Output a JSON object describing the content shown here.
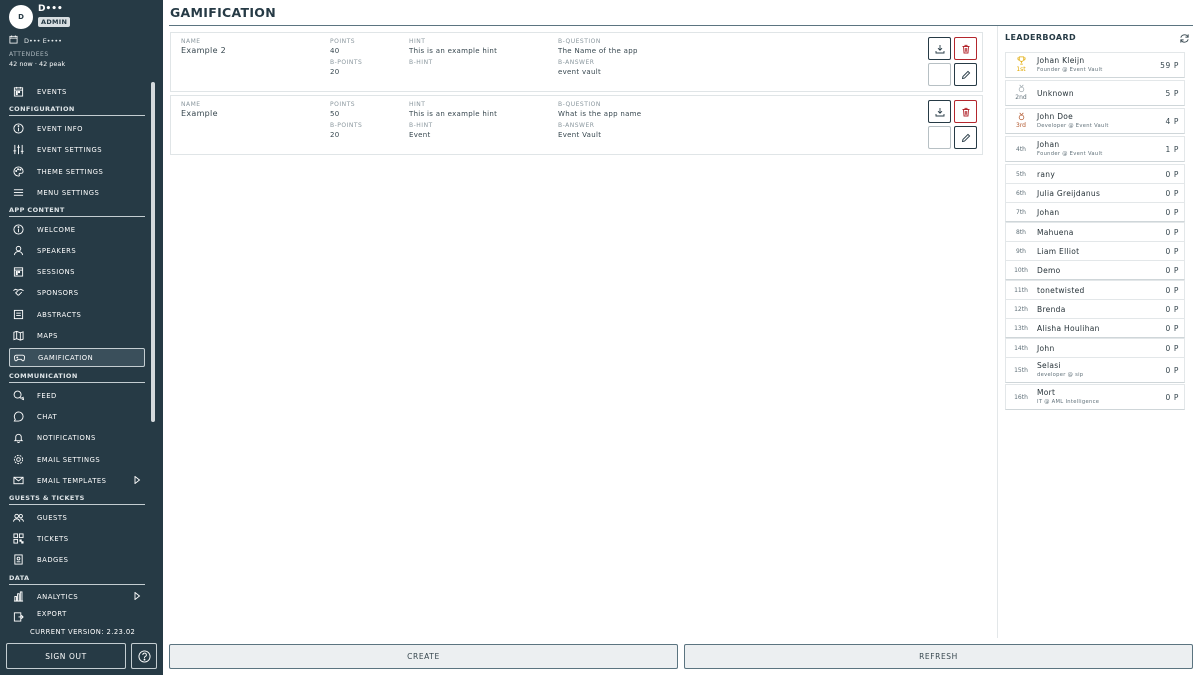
{
  "user": {
    "initial": "D",
    "name": "D•••",
    "role": "ADMIN"
  },
  "event": {
    "name": "D••• E••••",
    "attendees_label": "ATTENDEES",
    "attendees_value": "42 now · 42 peak"
  },
  "sidebar": {
    "events": "EVENTS",
    "sections": {
      "configuration": "CONFIGURATION",
      "app_content": "APP CONTENT",
      "communication": "COMMUNICATION",
      "guests_tickets": "GUESTS & TICKETS",
      "data": "DATA"
    },
    "items": {
      "event_info": "EVENT INFO",
      "event_settings": "EVENT SETTINGS",
      "theme_settings": "THEME SETTINGS",
      "menu_settings": "MENU SETTINGS",
      "welcome": "WELCOME",
      "speakers": "SPEAKERS",
      "sessions": "SESSIONS",
      "sponsors": "SPONSORS",
      "abstracts": "ABSTRACTS",
      "maps": "MAPS",
      "gamification": "GAMIFICATION",
      "feed": "FEED",
      "chat": "CHAT",
      "notifications": "NOTIFICATIONS",
      "email_settings": "EMAIL SETTINGS",
      "email_templates": "EMAIL TEMPLATES",
      "guests": "GUESTS",
      "tickets": "TICKETS",
      "badges": "BADGES",
      "analytics": "ANALYTICS",
      "export": "EXPORT"
    },
    "active_item": "GAMIFICATION",
    "version": "CURRENT VERSION: 2.23.02",
    "sign_out": "SIGN OUT"
  },
  "page": {
    "title": "GAMIFICATION"
  },
  "labels": {
    "name": "NAME",
    "points": "POINTS",
    "hint": "HINT",
    "b_question": "B-QUESTION",
    "b_points": "B-POINTS",
    "b_hint": "B-HINT",
    "b_answer": "B-ANSWER"
  },
  "items": [
    {
      "name": "Example 2",
      "points": "40",
      "hint": "This is an example hint",
      "b_question": "The Name of the app",
      "b_points": "20",
      "b_hint": "",
      "b_answer": "event vault"
    },
    {
      "name": "Example",
      "points": "50",
      "hint": "This is an example hint",
      "b_question": "What is the app name",
      "b_points": "20",
      "b_hint": "Event",
      "b_answer": "Event Vault"
    }
  ],
  "leaderboard": {
    "title": "LEADERBOARD",
    "entries": [
      {
        "rank": "1st",
        "name": "Johan Kleijn",
        "sub": "Founder @ Event Vault",
        "points": "59 P",
        "medal": "gold"
      },
      {
        "rank": "2nd",
        "name": "Unknown",
        "sub": "",
        "points": "5 P",
        "medal": "silver"
      },
      {
        "rank": "3rd",
        "name": "John Doe",
        "sub": "Developer @  Event Vault",
        "points": "4 P",
        "medal": "bronze"
      },
      {
        "rank": "4th",
        "name": "Johan",
        "sub": "Founder @ Event Vault",
        "points": "1 P",
        "medal": ""
      },
      {
        "rank": "5th",
        "name": "rany",
        "sub": "",
        "points": "0 P",
        "medal": ""
      },
      {
        "rank": "6th",
        "name": "Julia Greijdanus",
        "sub": "",
        "points": "0 P",
        "medal": ""
      },
      {
        "rank": "7th",
        "name": "Johan",
        "sub": "",
        "points": "0 P",
        "medal": ""
      },
      {
        "rank": "8th",
        "name": "Mahuena",
        "sub": "",
        "points": "0 P",
        "medal": ""
      },
      {
        "rank": "9th",
        "name": "Liam Elliot",
        "sub": "",
        "points": "0 P",
        "medal": ""
      },
      {
        "rank": "10th",
        "name": "Demo",
        "sub": "",
        "points": "0 P",
        "medal": ""
      },
      {
        "rank": "11th",
        "name": "tonetwisted",
        "sub": "",
        "points": "0 P",
        "medal": ""
      },
      {
        "rank": "12th",
        "name": "Brenda",
        "sub": "",
        "points": "0 P",
        "medal": ""
      },
      {
        "rank": "13th",
        "name": "Alisha Houlihan",
        "sub": "",
        "points": "0 P",
        "medal": ""
      },
      {
        "rank": "14th",
        "name": "John",
        "sub": "",
        "points": "0 P",
        "medal": ""
      },
      {
        "rank": "15th",
        "name": "Selasi",
        "sub": "developer @ sip",
        "points": "0 P",
        "medal": ""
      },
      {
        "rank": "16th",
        "name": "Mort",
        "sub": "IT @ AML Intelligence",
        "points": "0 P",
        "medal": ""
      }
    ]
  },
  "actions": {
    "create": "CREATE",
    "refresh": "REFRESH"
  },
  "colors": {
    "sidebar_bg": "#263a45",
    "accent": "#263a45",
    "danger": "#b3262d",
    "gold": "#e0a800",
    "bronze": "#b0552b"
  }
}
